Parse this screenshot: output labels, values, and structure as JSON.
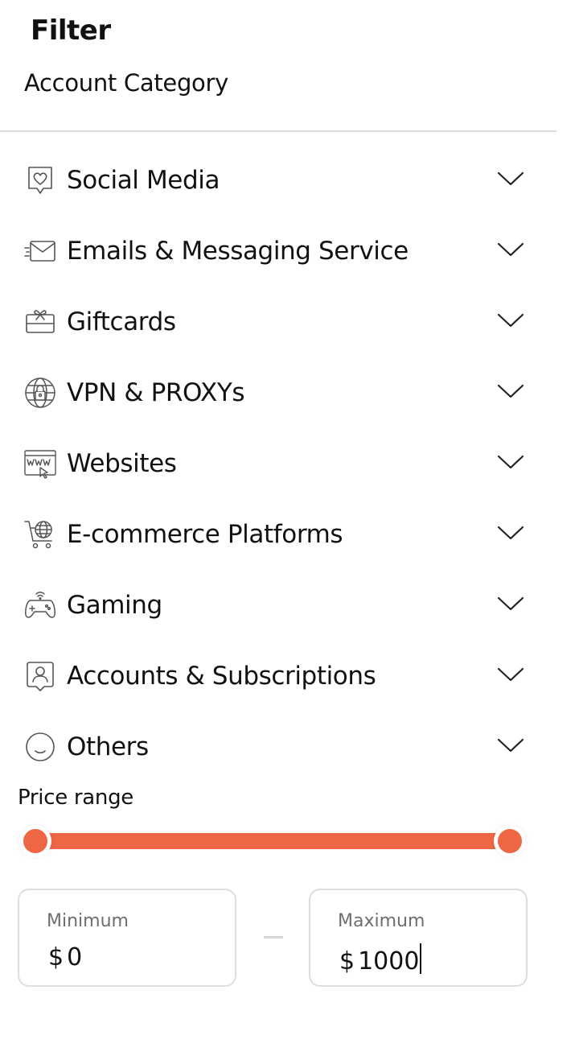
{
  "filter": {
    "title": "Filter",
    "section_title": "Account Category"
  },
  "categories": [
    {
      "label": "Social Media",
      "icon": "heart-chat-icon"
    },
    {
      "label": "Emails & Messaging Service",
      "icon": "envelope-icon"
    },
    {
      "label": "Giftcards",
      "icon": "gift-card-icon"
    },
    {
      "label": "VPN & PROXYs",
      "icon": "globe-lock-icon"
    },
    {
      "label": "Websites",
      "icon": "browser-www-icon"
    },
    {
      "label": "E-commerce Platforms",
      "icon": "cart-globe-icon"
    },
    {
      "label": "Gaming",
      "icon": "gamepad-icon"
    },
    {
      "label": "Accounts & Subscriptions",
      "icon": "user-badge-icon"
    },
    {
      "label": "Others",
      "icon": "smiley-icon"
    }
  ],
  "price_range": {
    "label": "Price range",
    "min_label": "Minimum",
    "max_label": "Maximum",
    "currency": "$",
    "min_value": "0",
    "max_value": "1000",
    "selected_fraction_start": 0,
    "selected_fraction_end": 1
  },
  "colors": {
    "accent": "#ee6644",
    "divider": "#dcdcdc",
    "muted_text": "#6e6e6e"
  }
}
